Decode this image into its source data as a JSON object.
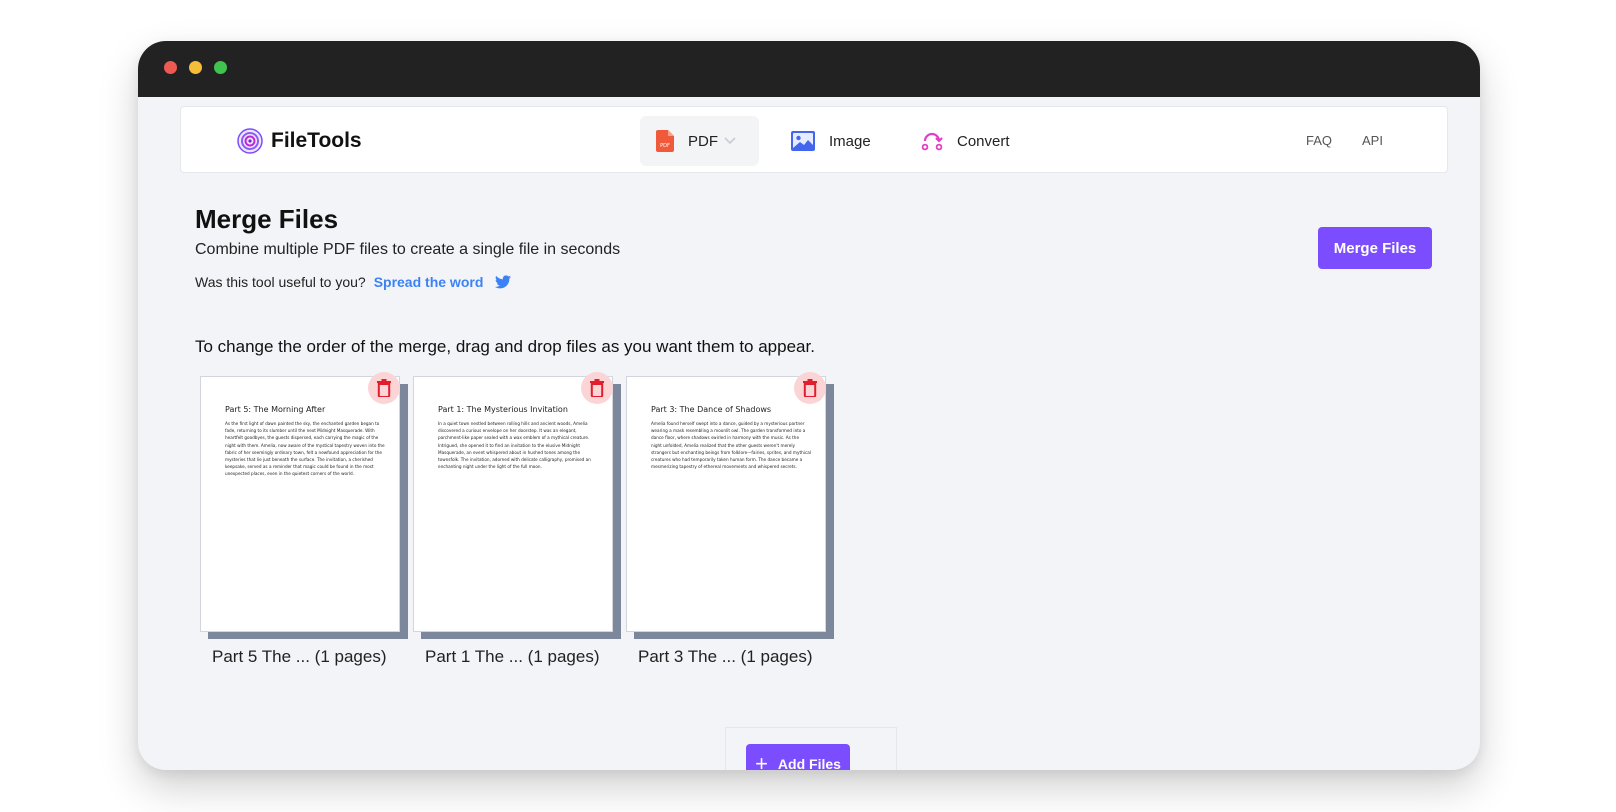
{
  "window": {
    "controls": [
      "close",
      "minimize",
      "maximize"
    ]
  },
  "nav": {
    "brand": "FileTools",
    "items": [
      {
        "label": "PDF",
        "icon": "pdf-file-icon",
        "active": true,
        "has_dropdown": true
      },
      {
        "label": "Image",
        "icon": "image-icon"
      },
      {
        "label": "Convert",
        "icon": "convert-icon"
      }
    ],
    "links": [
      "FAQ",
      "API"
    ]
  },
  "page": {
    "title": "Merge Files",
    "subtitle": "Combine multiple PDF files to create a single file in seconds",
    "useful_prompt": "Was this tool useful to you?",
    "spread_link": "Spread the word",
    "merge_button": "Merge Files",
    "instruction": "To change the order of the merge, drag and drop files as you want them to appear.",
    "add_button": "Add Files"
  },
  "files": [
    {
      "preview_title": "Part 5: The Morning After",
      "preview_text": "As the first light of dawn painted the sky, the enchanted garden began to fade, returning to its slumber until the next Midnight Masquerade. With heartfelt goodbyes, the guests dispersed, each carrying the magic of the night with them. Amelia, now aware of the mystical tapestry woven into the fabric of her seemingly ordinary town, felt a newfound appreciation for the mysteries that lie just beneath the surface. The invitation, a cherished keepsake, served as a reminder that magic could be found in the most unexpected places, even in the quietest corners of the world.",
      "label": "Part 5 The ... (1 pages)"
    },
    {
      "preview_title": "Part 1: The Mysterious Invitation",
      "preview_text": "In a quiet town nestled between rolling hills and ancient woods, Amelia discovered a curious envelope on her doorstep. It was an elegant, parchment-like paper sealed with a wax emblem of a mythical creature. Intrigued, she opened it to find an invitation to the elusive Midnight Masquerade, an event whispered about in hushed tones among the townsfolk. The invitation, adorned with delicate calligraphy, promised an enchanting night under the light of the full moon.",
      "label": "Part 1 The ... (1 pages)"
    },
    {
      "preview_title": "Part 3: The Dance of Shadows",
      "preview_text": "Amelia found herself swept into a dance, guided by a mysterious partner wearing a mask resembling a moonlit owl. The garden transformed into a dance floor, where shadows swirled in harmony with the music. As the night unfolded, Amelia realized that the other guests weren't merely strangers but enchanting beings from folklore—fairies, sprites, and mythical creatures who had temporarily taken human form. The dance became a mesmerizing tapestry of ethereal movements and whispered secrets.",
      "label": "Part 3 The ... (1 pages)"
    }
  ],
  "colors": {
    "accent": "#7c4dff",
    "link": "#3b82f6",
    "pdf_icon": "#f05a3a",
    "image_icon": "#4466ee",
    "convert_icon": "#e040c8",
    "delete_bg": "#fbd5d5",
    "delete_icon": "#e11d2e",
    "titlebar": "#222222"
  }
}
